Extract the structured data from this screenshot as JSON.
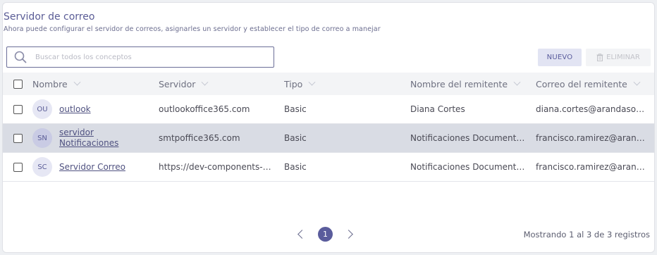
{
  "header": {
    "title": "Servidor de correo",
    "subtitle": "Ahora puede configurar el servidor de correos, asignarles un servidor y establecer el tipo de correo a manejar"
  },
  "search": {
    "placeholder": "Buscar todos los conceptos",
    "value": ""
  },
  "toolbar": {
    "new_label": "NUEVO",
    "delete_label": "ELIMINAR"
  },
  "table": {
    "columns": [
      "Nombre",
      "Servidor",
      "Tipo",
      "Nombre del remitente",
      "Correo del remitente"
    ],
    "rows": [
      {
        "initials": "OU",
        "name": "outlook",
        "server": "outlookoffice365.com",
        "type": "Basic",
        "sender_name": "Diana Cortes",
        "sender_email": "diana.cortes@arandasoft.com",
        "selected": false
      },
      {
        "initials": "SN",
        "name": "servidor Notificaciones",
        "server": "smtpoffice365.com",
        "type": "Basic",
        "sender_name": "Notificaciones Documentación",
        "sender_email": "francisco.ramirez@arandasoft.com",
        "selected": true
      },
      {
        "initials": "SC",
        "name": "Servidor Correo",
        "server": "https://dev-components-n...",
        "type": "Basic",
        "sender_name": "Notificaciones Documentación",
        "sender_email": "francisco.ramirez@arandasoft.com",
        "selected": false
      }
    ]
  },
  "pagination": {
    "current_page": "1",
    "summary": "Mostrando 1 al 3 de 3 registros"
  },
  "colors": {
    "accent": "#5a5c9c",
    "selected_row": "#d9dce4",
    "header_row": "#f3f4f6"
  }
}
